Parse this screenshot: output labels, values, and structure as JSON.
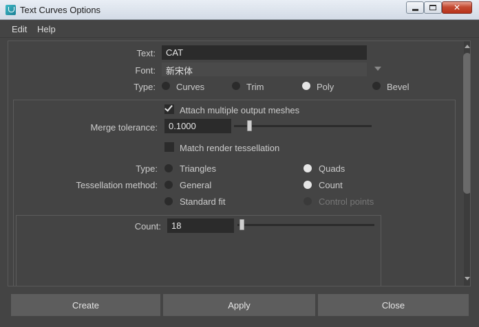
{
  "window": {
    "title": "Text Curves Options"
  },
  "menu": {
    "edit": "Edit",
    "help": "Help"
  },
  "form": {
    "text_label": "Text:",
    "text_value": "CAT",
    "font_label": "Font:",
    "font_value": "新宋体",
    "type_label": "Type:",
    "type_options": [
      "Curves",
      "Trim",
      "Poly",
      "Bevel"
    ],
    "type_selected": "Poly"
  },
  "poly": {
    "attach_label": "Attach multiple output meshes",
    "attach_checked": true,
    "merge_label": "Merge tolerance:",
    "merge_value": "0.1000",
    "match_label": "Match render tessellation",
    "match_checked": false,
    "type_label": "Type:",
    "type_options": [
      "Triangles",
      "Quads"
    ],
    "type_selected": "Quads",
    "tess_label": "Tessellation method:",
    "tess_options": [
      "General",
      "Count",
      "Standard fit",
      "Control points"
    ],
    "tess_selected": "Count",
    "tess_disabled": "Control points",
    "count_label": "Count:",
    "count_value": "18"
  },
  "buttons": {
    "create": "Create",
    "apply": "Apply",
    "close": "Close"
  }
}
